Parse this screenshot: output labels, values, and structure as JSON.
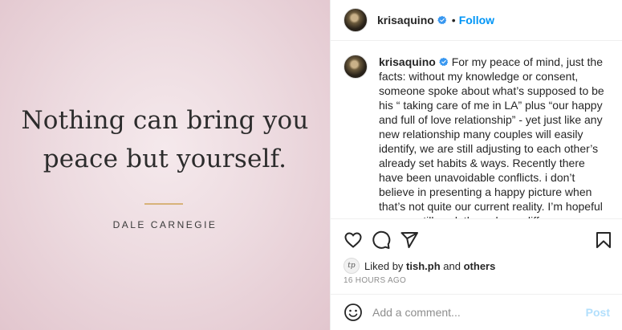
{
  "image": {
    "quote_lines": [
      "Nothing can bring you",
      "peace but yourself."
    ],
    "author": "DALE CARNEGIE"
  },
  "header": {
    "username": "krisaquino",
    "separator": "•",
    "follow_label": "Follow"
  },
  "caption": {
    "username": "krisaquino",
    "text": "For my peace of mind, just the facts: without my knowledge or consent, someone spoke about what’s supposed to be his “ taking care of me in LA” plus “our happy and full of love relationship” - yet just like any new relationship many couples will easily identify, we are still adjusting to each other’s already set habits & ways. Recently there have been unavoidable conflicts. i don’t believe in presenting a happy picture when that’s not quite our current reality. I’m hopeful we can still work through our differences, though a part of me realizes the lack of wisdom in embarking on"
  },
  "actions": {
    "icons": [
      "heart-icon",
      "comment-icon",
      "share-icon",
      "save-icon"
    ]
  },
  "likes": {
    "prefix": "Liked by",
    "user": "tish.ph",
    "conjunction": "and",
    "others": "others",
    "avatar_initials": "tp"
  },
  "timestamp": "16 HOURS AGO",
  "comment": {
    "placeholder": "Add a comment...",
    "post_label": "Post"
  },
  "colors": {
    "accent": "#0095f6",
    "post_disabled": "#b2dffc",
    "verified": "#3897f0",
    "divider_gold": "#d8b27a"
  }
}
